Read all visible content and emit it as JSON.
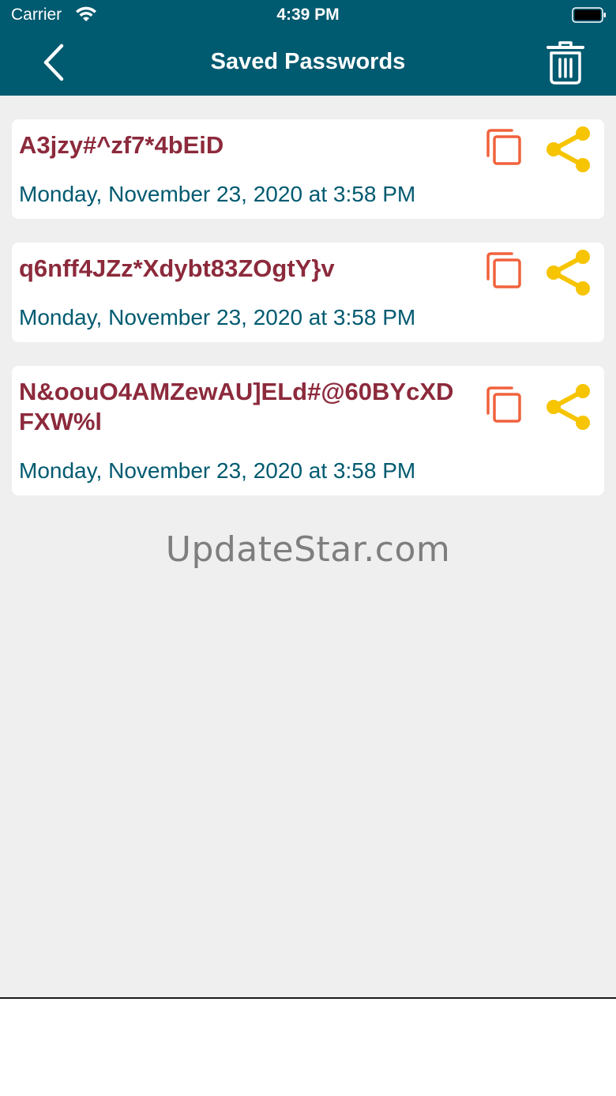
{
  "status_bar": {
    "carrier": "Carrier",
    "time": "4:39 PM"
  },
  "nav": {
    "title": "Saved Passwords",
    "back_icon": "chevron-left-icon",
    "trash_icon": "trash-icon"
  },
  "colors": {
    "header_bg": "#005a70",
    "password_text": "#8c2a3c",
    "date_text": "#005a70",
    "copy_icon": "#f0623c",
    "share_icon": "#f6c400",
    "background": "#efefef"
  },
  "passwords": [
    {
      "value": "A3jzy#^zf7*4bEiD",
      "date": "Monday, November 23, 2020 at 3:58 PM"
    },
    {
      "value": "q6nff4JZz*Xdybt83ZOgtY}v",
      "date": "Monday, November 23, 2020 at 3:58 PM"
    },
    {
      "value": "N&oouO4AMZewAU]ELd#@60BYcXDFXW%l",
      "date": "Monday, November 23, 2020 at 3:58 PM"
    }
  ],
  "watermark": "UpdateStar.com"
}
